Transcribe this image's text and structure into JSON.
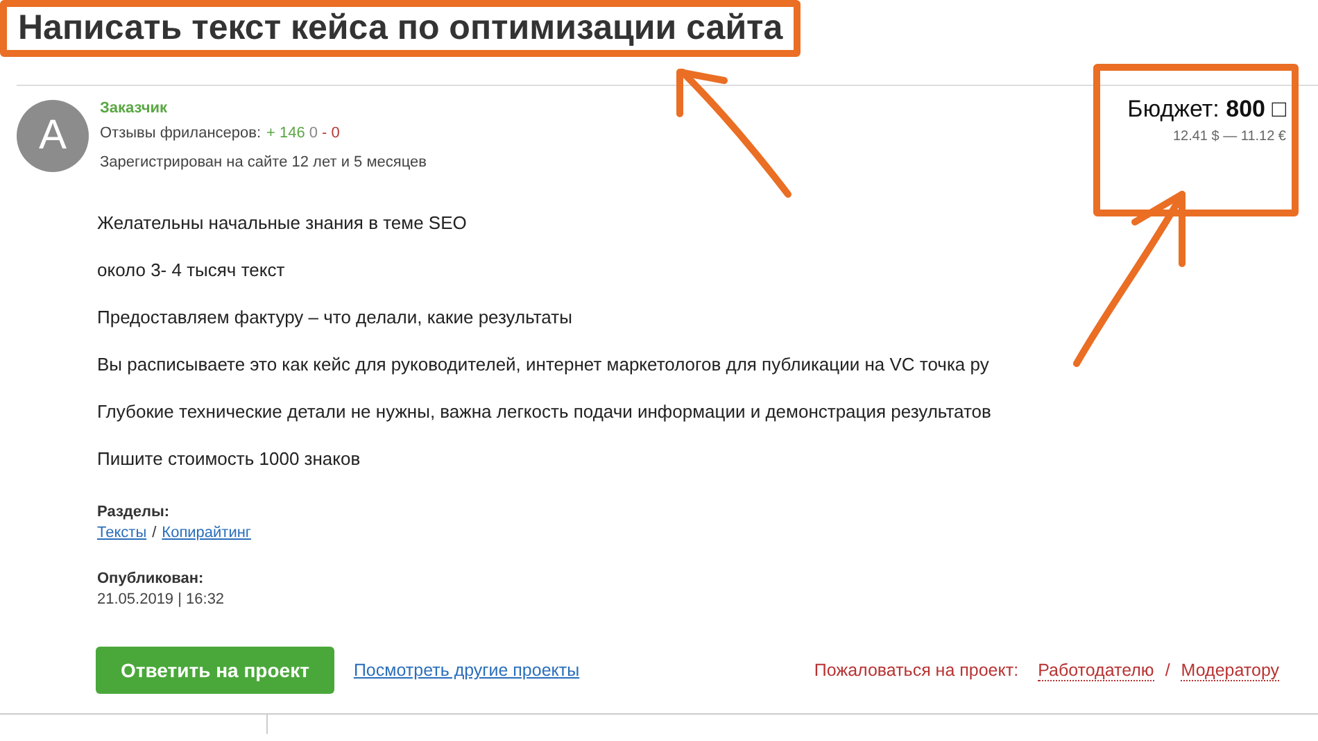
{
  "title": "Написать текст кейса по оптимизации сайта",
  "customer": {
    "avatar_letter": "A",
    "role": "Заказчик",
    "reviews_label": "Отзывы фрилансеров:",
    "reviews_positive": "+ 146",
    "reviews_neutral": "0",
    "reviews_negative": "- 0",
    "registered": "Зарегистрирован на сайте 12 лет и 5 месяцев"
  },
  "budget": {
    "text": "Бюджет: **800** □",
    "conversion": "12.41 $ — 11.12 €"
  },
  "description": [
    "Желательны начальные знания в теме SEO",
    "около  3- 4 тысяч текст",
    "Предоставляем фактуру – что делали, какие результаты",
    "Вы расписываете это как кейс для руководителей, интернет маркетологов для публикации на VC точка ру",
    "Глубокие технические детали не нужны, важна легкость подачи информации и демонстрация результатов",
    "Пишите стоимость 1000 знаков"
  ],
  "sections": {
    "label": "Разделы:",
    "links": [
      "Тексты",
      "Копирайтинг"
    ],
    "separator": "/"
  },
  "published": {
    "label": "Опубликован:",
    "date": "21.05.2019 | 16:32"
  },
  "actions": {
    "reply_button": "Ответить на проект",
    "other_projects_link": "Посмотреть другие проекты",
    "complaint_label": "Пожаловаться на проект:",
    "complaint_links": [
      "Работодателю",
      "Модератору"
    ],
    "separator": "/"
  }
}
